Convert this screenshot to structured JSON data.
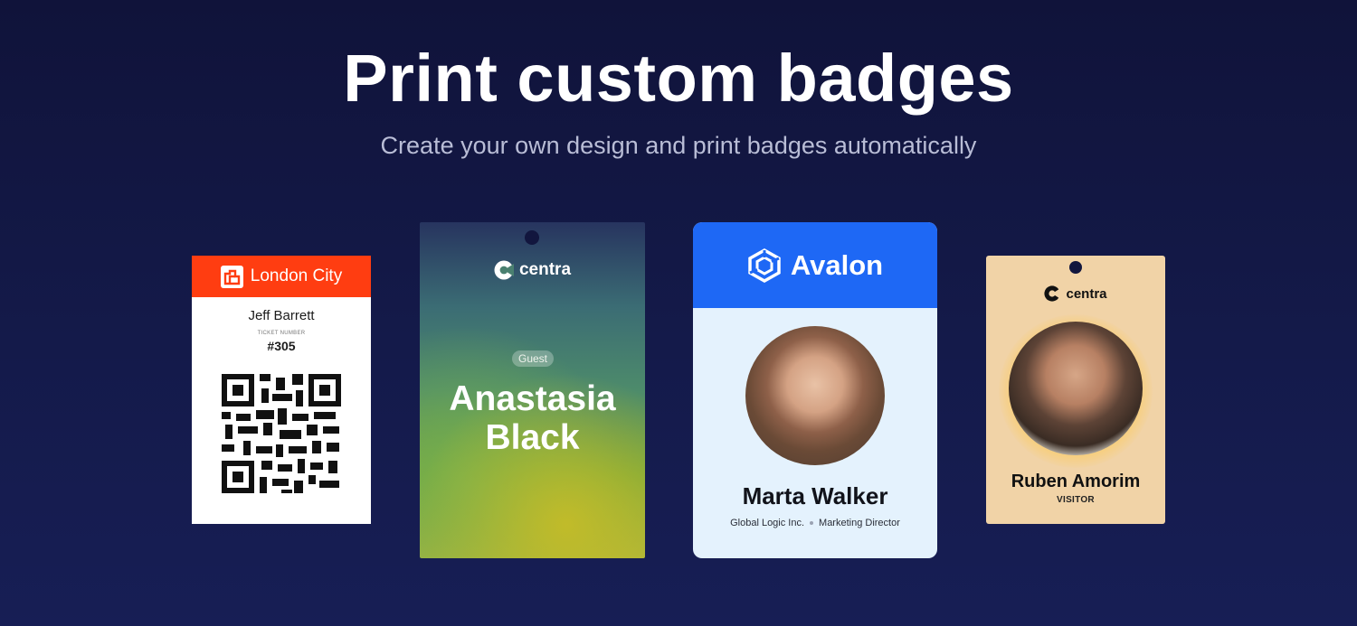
{
  "hero": {
    "title": "Print custom badges",
    "subtitle": "Create your own design and print badges automatically"
  },
  "badges": [
    {
      "brand": "London City",
      "name": "Jeff Barrett",
      "ticket_label": "TICKET NUMBER",
      "ticket_number": "#305",
      "accent": "#ff3d11",
      "icons": [
        "london-city-logo-icon",
        "qr-code-icon"
      ]
    },
    {
      "brand": "centra",
      "tag": "Guest",
      "first_name": "Anastasia",
      "last_name": "Black",
      "icons": [
        "centra-logo-icon"
      ]
    },
    {
      "brand": "Avalon",
      "name": "Marta Walker",
      "company": "Global Logic Inc.",
      "title": "Marketing Director",
      "accent": "#1e68f5",
      "icons": [
        "avalon-logo-icon",
        "portrait-photo"
      ]
    },
    {
      "brand": "centra",
      "name": "Ruben Amorim",
      "role": "VISITOR",
      "background": "#f1d3a7",
      "icons": [
        "centra-logo-icon",
        "portrait-photo"
      ]
    }
  ],
  "colors": {
    "background": "#141a4a",
    "hero_text": "#ffffff",
    "subtitle_text": "#b9bdd6"
  }
}
